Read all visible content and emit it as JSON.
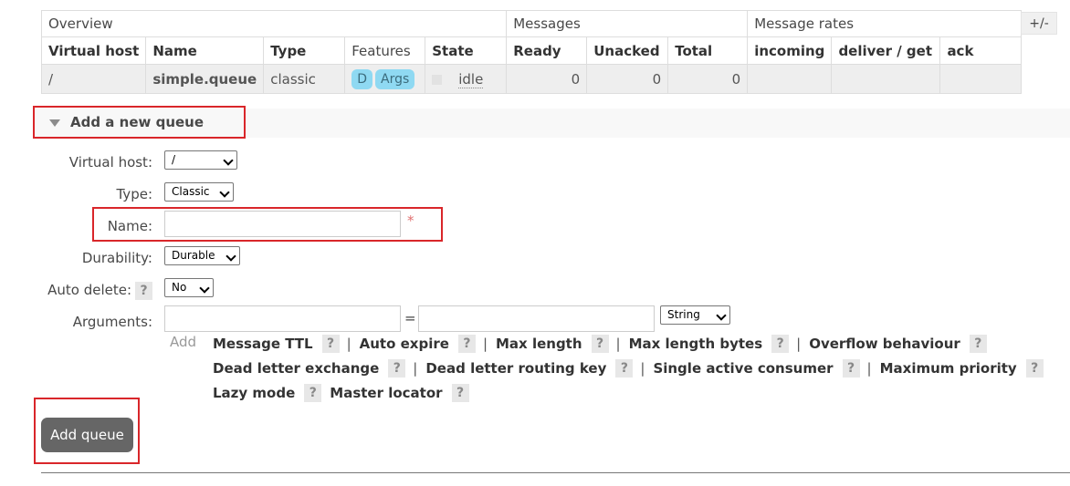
{
  "table": {
    "group_headers": [
      "Overview",
      "Messages",
      "Message rates"
    ],
    "columns": [
      "Virtual host",
      "Name",
      "Type",
      "Features",
      "State",
      "Ready",
      "Unacked",
      "Total",
      "incoming",
      "deliver / get",
      "ack"
    ],
    "toggle_label": "+/-",
    "row": {
      "virtual_host": "/",
      "name": "simple.queue",
      "type": "classic",
      "features": [
        "D",
        "Args"
      ],
      "state": "idle",
      "ready": "0",
      "unacked": "0",
      "total": "0",
      "incoming": "",
      "deliver_get": "",
      "ack": ""
    }
  },
  "section": {
    "title": "Add a new queue"
  },
  "form": {
    "virtual_host_label": "Virtual host:",
    "virtual_host_value": "/",
    "type_label": "Type:",
    "type_value": "Classic",
    "name_label": "Name:",
    "name_value": "",
    "required_mark": "*",
    "durability_label": "Durability:",
    "durability_value": "Durable",
    "auto_delete_label": "Auto delete:",
    "auto_delete_help": "?",
    "auto_delete_value": "No",
    "arguments_label": "Arguments:",
    "arguments_equals": "=",
    "arguments_type_value": "String",
    "add_label": "Add",
    "argument_shortcuts_row1": [
      "Message TTL",
      "Auto expire",
      "Max length",
      "Max length bytes",
      "Overflow behaviour"
    ],
    "argument_shortcuts_row2": [
      "Dead letter exchange",
      "Dead letter routing key",
      "Single active consumer",
      "Maximum priority"
    ],
    "argument_shortcuts_row3": [
      "Lazy mode",
      "Master locator"
    ],
    "help_mark": "?",
    "separator": "|",
    "submit_label": "Add queue"
  }
}
